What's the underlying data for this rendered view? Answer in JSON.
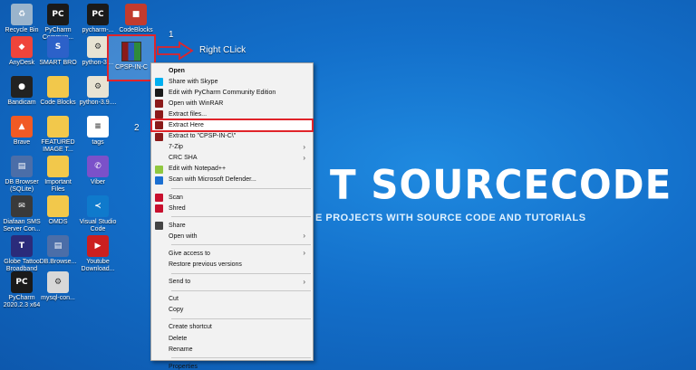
{
  "desktop": {
    "icons": [
      {
        "label": "Recycle Bin",
        "icon": "recycle-bin-icon",
        "color": "#9ab4cc",
        "glyph": "♻"
      },
      {
        "label": "PyCharm Commun...",
        "icon": "pycharm-icon",
        "color": "#1a1a1a",
        "glyph": "PC"
      },
      {
        "label": "pycharm-...",
        "icon": "pycharm-icon",
        "color": "#1a1a1a",
        "glyph": "PC"
      },
      {
        "label": "CodeBlocks",
        "icon": "codeblocks-icon",
        "color": "#c23b2e",
        "glyph": "■"
      },
      {
        "label": "AnyDesk",
        "icon": "anydesk-icon",
        "color": "#ef443b",
        "glyph": "◆"
      },
      {
        "label": "SMART BRO",
        "icon": "smart-bro-icon",
        "color": "#2c61c9",
        "glyph": "S"
      },
      {
        "label": "python-3....",
        "icon": "python-installer-icon",
        "color": "#e8e3d3",
        "glyph": "⚙"
      },
      {
        "label": "Bandicam",
        "icon": "bandicam-icon",
        "color": "#222222",
        "glyph": "●"
      },
      {
        "label": "Code Blocks",
        "icon": "folder-icon",
        "color": "#f2c84b",
        "glyph": ""
      },
      {
        "label": "python-3.9....",
        "icon": "python-installer-icon",
        "color": "#e8e3d3",
        "glyph": "⚙"
      },
      {
        "label": "Brave",
        "icon": "brave-icon",
        "color": "#f15a24",
        "glyph": "▲"
      },
      {
        "label": "FEATURED IMAGE T...",
        "icon": "folder-icon",
        "color": "#f2c84b",
        "glyph": ""
      },
      {
        "label": "tags",
        "icon": "text-file-icon",
        "color": "#ffffff",
        "glyph": "≡"
      },
      {
        "label": "DB Browser (SQLite)",
        "icon": "db-browser-icon",
        "color": "#4b6ea8",
        "glyph": "▤"
      },
      {
        "label": "Important Files",
        "icon": "folder-icon",
        "color": "#f2c84b",
        "glyph": ""
      },
      {
        "label": "Viber",
        "icon": "viber-icon",
        "color": "#7b51c9",
        "glyph": "✆"
      },
      {
        "label": "Diafaan SMS Server Con...",
        "icon": "diafaan-sms-icon",
        "color": "#3a3a3a",
        "glyph": "✉"
      },
      {
        "label": "OMDS",
        "icon": "folder-icon",
        "color": "#f2c84b",
        "glyph": ""
      },
      {
        "label": "Visual Studio Code",
        "icon": "vscode-icon",
        "color": "#0f7acc",
        "glyph": "≺"
      },
      {
        "label": "Globe Tattoo Broadband",
        "icon": "globe-tattoo-icon",
        "color": "#2b2b7a",
        "glyph": "T"
      },
      {
        "label": "DB.Browse...",
        "icon": "db-browser-icon",
        "color": "#4b6ea8",
        "glyph": "▤"
      },
      {
        "label": "Youtube Download...",
        "icon": "youtube-downloader-icon",
        "color": "#cc1f1f",
        "glyph": "▶"
      },
      {
        "label": "PyCharm 2020.2.3 x64",
        "icon": "pycharm-icon",
        "color": "#1a1a1a",
        "glyph": "PC"
      },
      {
        "label": "mysql-con...",
        "icon": "installer-icon",
        "color": "#d8d8d8",
        "glyph": "⚙"
      }
    ],
    "selected_file": {
      "label": "CPSP-IN-C",
      "icon": "winrar-archive-icon"
    }
  },
  "annotations": {
    "step1": "1",
    "step1_text": "Right CLick",
    "step2": "2"
  },
  "watermark": {
    "title": "T SOURCECODE",
    "subtitle": "E PROJECTS WITH SOURCE CODE AND TUTORIALS"
  },
  "context_menu": {
    "items": [
      {
        "label": "Open",
        "icon": "",
        "bold": true
      },
      {
        "label": "Share with Skype",
        "icon": "skype-icon",
        "iconColor": "#00aff0"
      },
      {
        "label": "Edit with PyCharm Community Edition",
        "icon": "pycharm-icon",
        "iconColor": "#1a1a1a"
      },
      {
        "label": "Open with WinRAR",
        "icon": "winrar-icon",
        "iconColor": "#8b1a1a"
      },
      {
        "label": "Extract files...",
        "icon": "winrar-icon",
        "iconColor": "#8b1a1a"
      },
      {
        "label": "Extract Here",
        "icon": "winrar-icon",
        "iconColor": "#8b1a1a",
        "highlight": true
      },
      {
        "label": "Extract to \"CPSP-IN-C\\\"",
        "icon": "winrar-icon",
        "iconColor": "#8b1a1a"
      },
      {
        "label": "7-Zip",
        "icon": "",
        "submenu": true
      },
      {
        "label": "CRC SHA",
        "icon": "",
        "submenu": true
      },
      {
        "label": "Edit with Notepad++",
        "icon": "notepadpp-icon",
        "iconColor": "#90c840"
      },
      {
        "label": "Scan with Microsoft Defender...",
        "icon": "defender-icon",
        "iconColor": "#1b6fd1",
        "separator_after": true
      },
      {
        "label": "Scan",
        "icon": "mcafee-icon",
        "iconColor": "#c8102e"
      },
      {
        "label": "Shred",
        "icon": "mcafee-icon",
        "iconColor": "#c8102e",
        "separator_after": true
      },
      {
        "label": "Share",
        "icon": "share-icon",
        "iconColor": "#444444"
      },
      {
        "label": "Open with",
        "icon": "",
        "submenu": true,
        "separator_after": true
      },
      {
        "label": "Give access to",
        "icon": "",
        "submenu": true
      },
      {
        "label": "Restore previous versions",
        "icon": "",
        "separator_after": true
      },
      {
        "label": "Send to",
        "icon": "",
        "submenu": true,
        "separator_after": true
      },
      {
        "label": "Cut",
        "icon": ""
      },
      {
        "label": "Copy",
        "icon": "",
        "separator_after": true
      },
      {
        "label": "Create shortcut",
        "icon": ""
      },
      {
        "label": "Delete",
        "icon": ""
      },
      {
        "label": "Rename",
        "icon": "",
        "separator_after": true
      },
      {
        "label": "Properties",
        "icon": ""
      }
    ]
  },
  "colors": {
    "annotation_red": "#e0242a",
    "desktop_blue": "#136fca"
  }
}
